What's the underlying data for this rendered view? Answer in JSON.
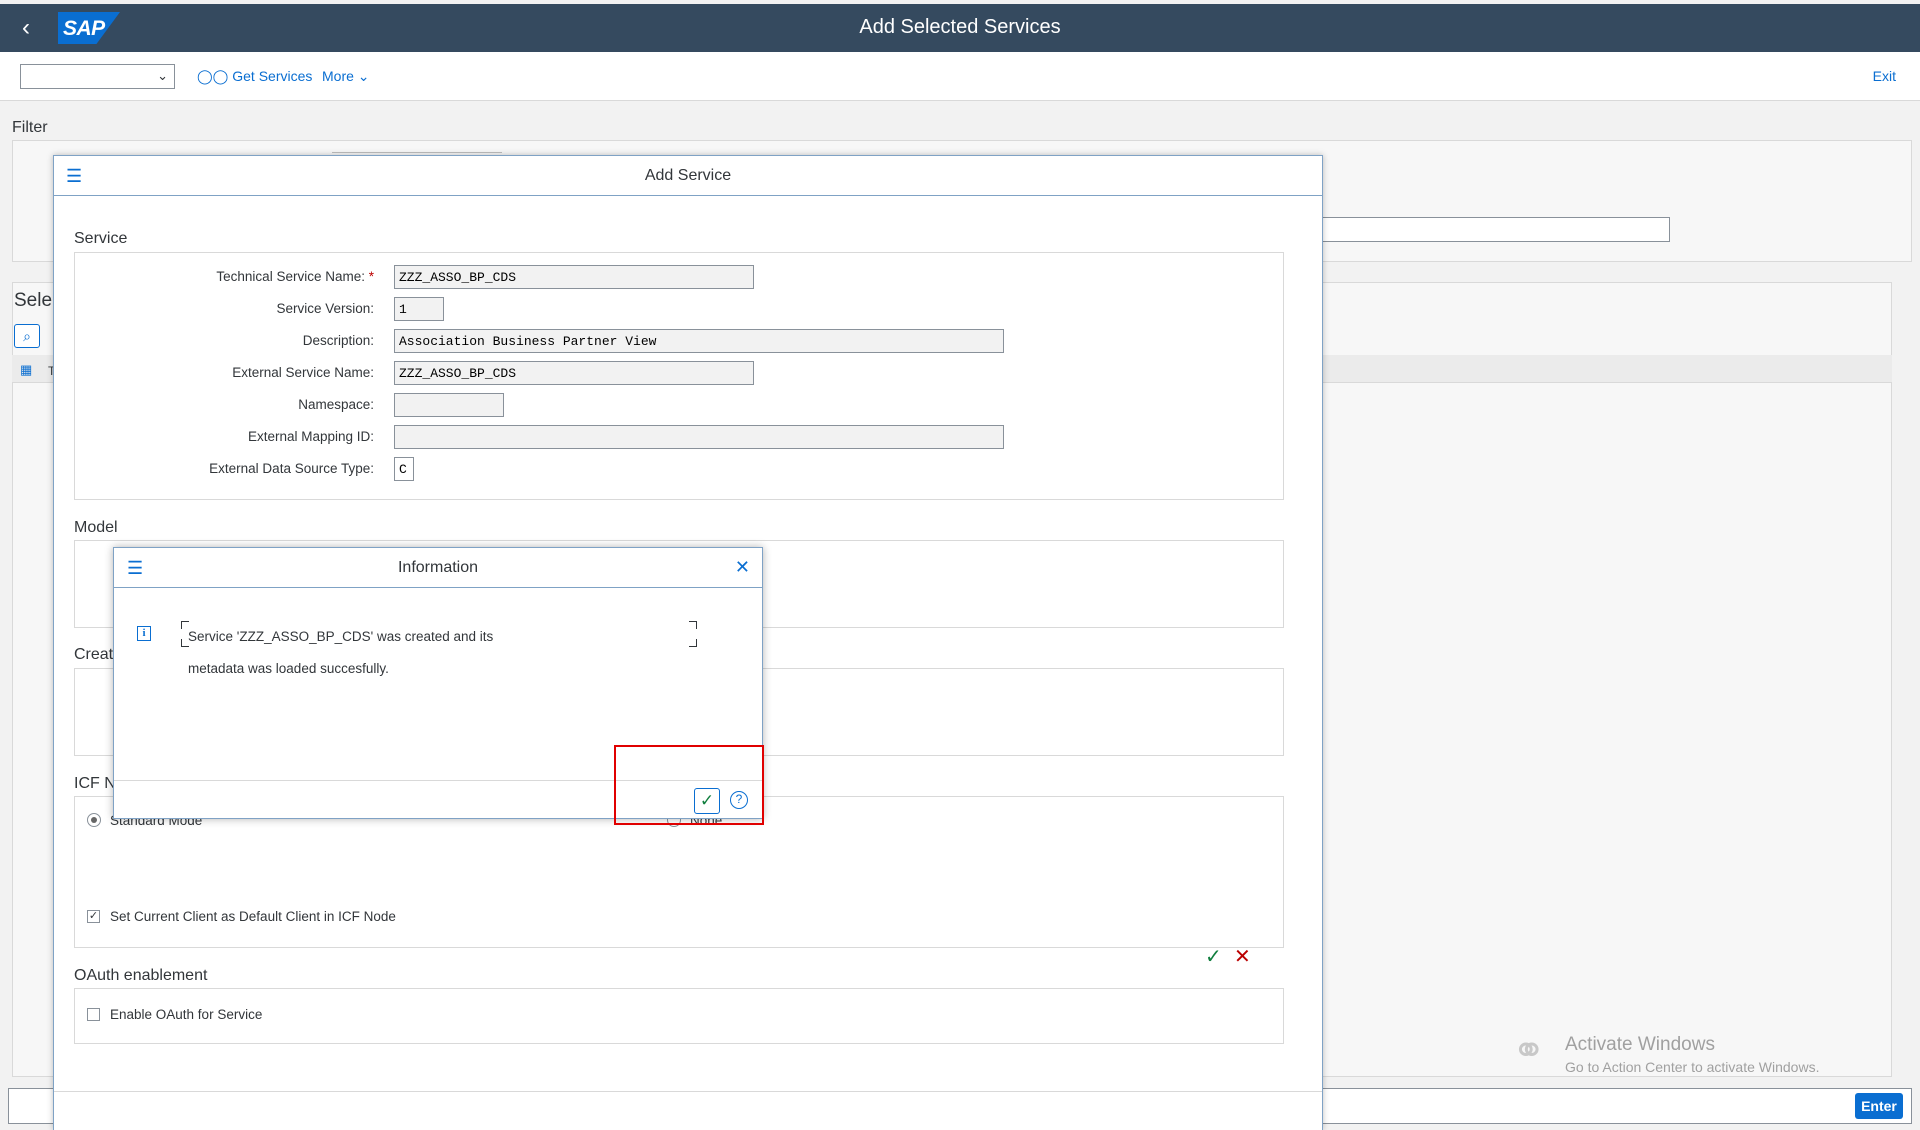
{
  "shell": {
    "title": "Add Selected Services",
    "logo": "SAP"
  },
  "toolbar": {
    "get_services": "Get Services",
    "more": "More",
    "exit": "Exit",
    "select_value": ""
  },
  "background": {
    "filter_label": "Filter",
    "sele_label": "Sele",
    "table_col_t": "T",
    "watermark_title": "Activate Windows",
    "watermark_sub": "Go to Action Center to activate Windows.",
    "enter": "Enter"
  },
  "add_service": {
    "title": "Add Service",
    "service_section": "Service",
    "fields": {
      "tech_name_label": "Technical Service Name:",
      "tech_name_req": "*",
      "tech_name": "ZZZ_ASSO_BP_CDS",
      "version_label": "Service Version:",
      "version": "1",
      "desc_label": "Description:",
      "desc": "Association Business Partner View",
      "ext_name_label": "External Service Name:",
      "ext_name": "ZZZ_ASSO_BP_CDS",
      "namespace_label": "Namespace:",
      "namespace": "",
      "mapping_label": "External Mapping ID:",
      "mapping": "",
      "datasource_label": "External Data Source Type:",
      "datasource": "C"
    },
    "model_section": "Model",
    "create_section": "Creat",
    "icf_section": "ICF N",
    "icf_standard": "Standard Mode",
    "icf_none": "None",
    "default_client": "Set Current Client as Default Client in ICF Node",
    "oauth_section": "OAuth enablement",
    "oauth_enable": "Enable OAuth for Service"
  },
  "info": {
    "title": "Information",
    "line1": "Service 'ZZZ_ASSO_BP_CDS' was created and its",
    "line2": "metadata was loaded succesfully."
  },
  "icons": {
    "back": "chevron-left-icon",
    "menu": "hamburger-menu-icon",
    "close": "close-icon",
    "info": "info-icon",
    "confirm": "checkmark-icon",
    "help": "help-icon",
    "cancel": "cancel-x-icon"
  },
  "colors": {
    "shell": "#354a5f",
    "accent": "#0a6ed1",
    "highlight": "#e00000",
    "ok": "#107e3e",
    "error": "#bb0000"
  }
}
